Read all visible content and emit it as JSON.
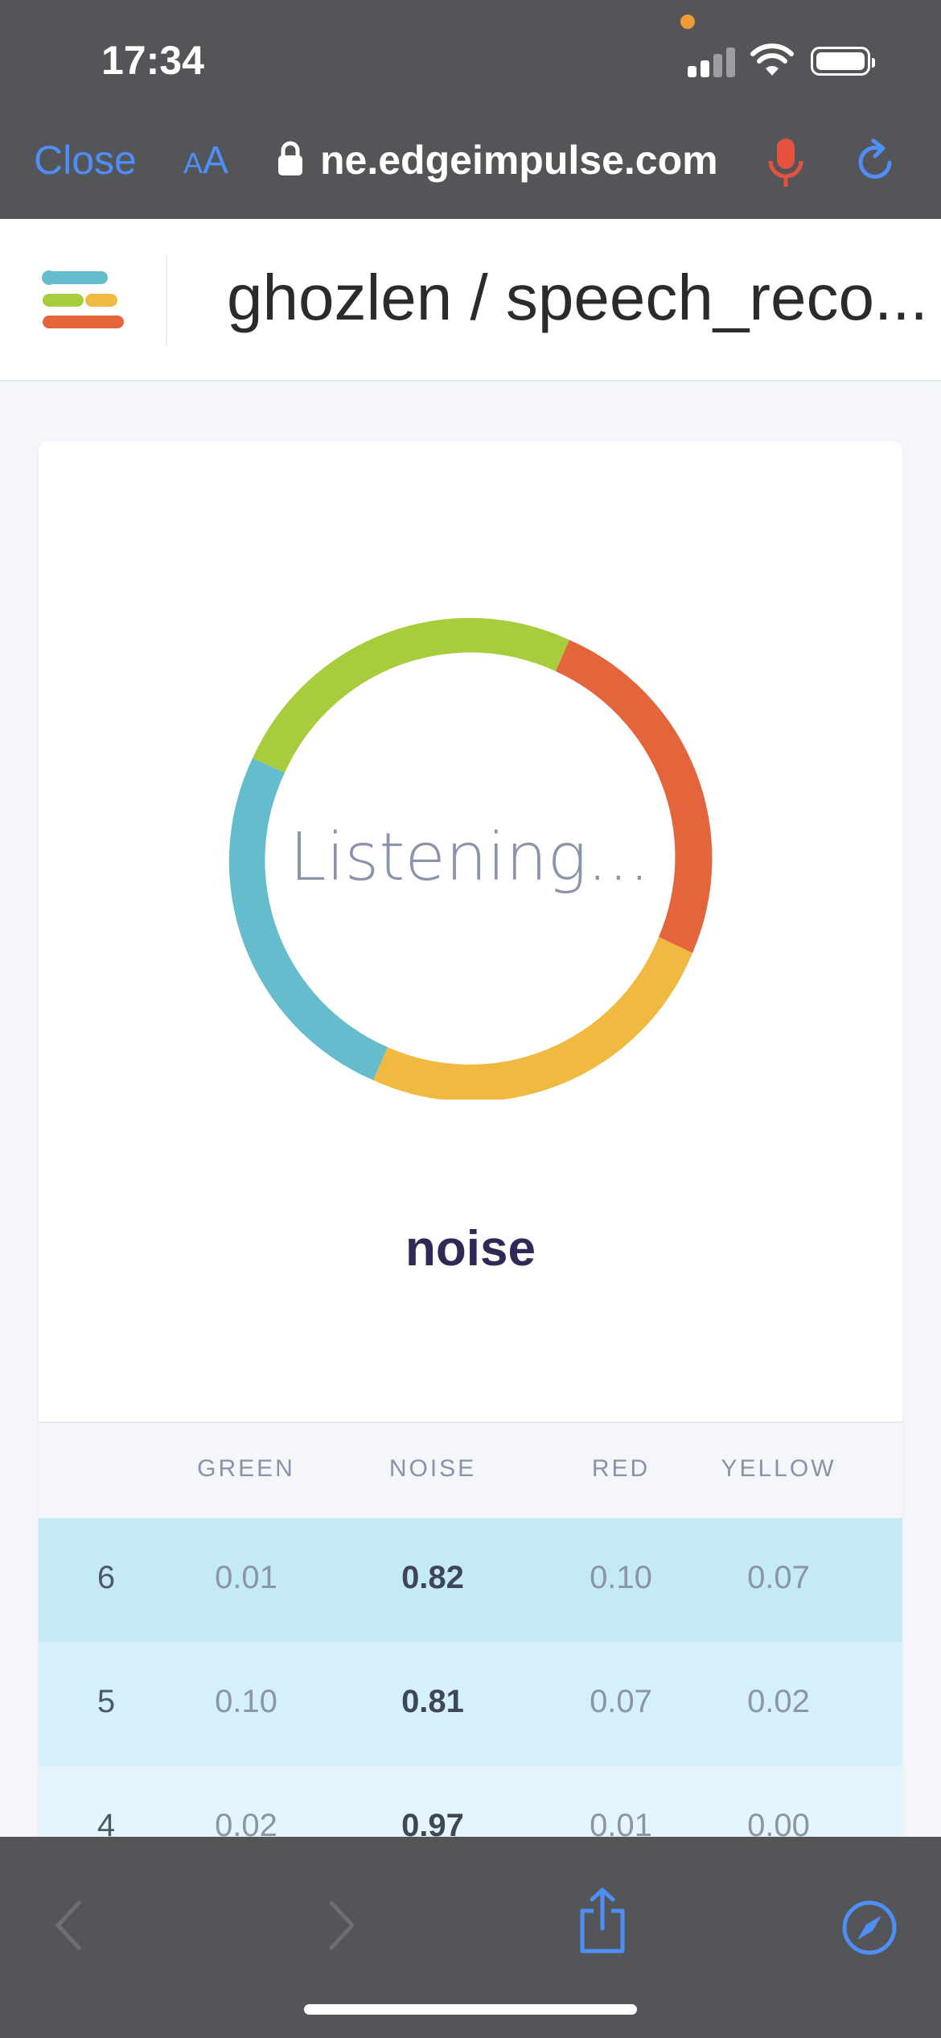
{
  "status_bar": {
    "time": "17:34"
  },
  "browser": {
    "close_label": "Close",
    "aa_label_small": "A",
    "aa_label_large": "A",
    "url": "ne.edgeimpulse.com"
  },
  "header": {
    "project_title": "ghozlen / speech_reco..."
  },
  "classifier": {
    "status_text": "Listening...",
    "prediction": "noise",
    "ring_segments": [
      {
        "label": "green",
        "color": "#a8cd3c"
      },
      {
        "label": "red",
        "color": "#e4643b"
      },
      {
        "label": "yellow",
        "color": "#f0ba42"
      },
      {
        "label": "blue",
        "color": "#64bccc"
      }
    ]
  },
  "table": {
    "columns": [
      "",
      "GREEN",
      "NOISE",
      "RED",
      "YELLOW"
    ],
    "rows": [
      {
        "idx": "6",
        "green": "0.01",
        "noise": "0.82",
        "red": "0.10",
        "yellow": "0.07",
        "bg": "#c4ebf5"
      },
      {
        "idx": "5",
        "green": "0.10",
        "noise": "0.81",
        "red": "0.07",
        "yellow": "0.02",
        "bg": "#d4f0f8"
      },
      {
        "idx": "4",
        "green": "0.02",
        "noise": "0.97",
        "red": "0.01",
        "yellow": "0.00",
        "bg": "#e4f5fb"
      }
    ]
  },
  "colors": {
    "accent": "#4f8ef7",
    "chrome": "#545558",
    "mic": "#e5533f"
  }
}
